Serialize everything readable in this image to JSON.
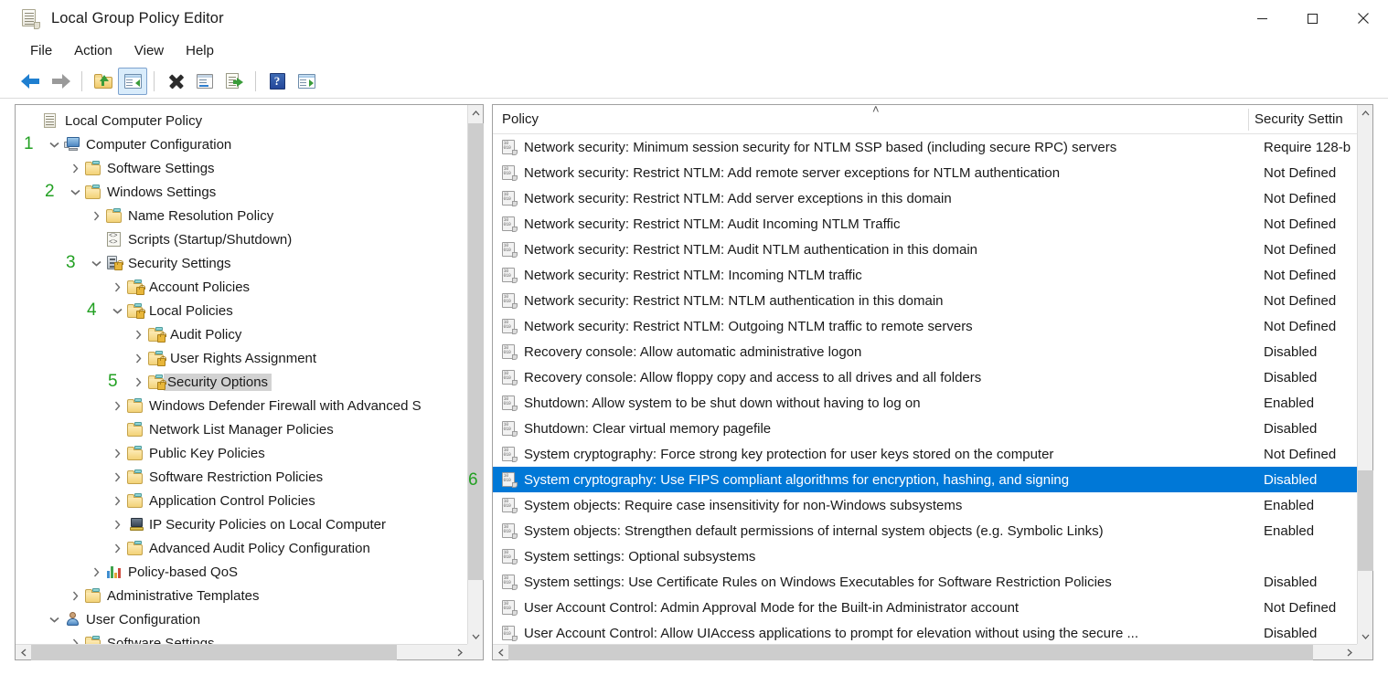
{
  "window": {
    "title": "Local Group Policy Editor",
    "icon": "policy-scroll-icon",
    "controls": {
      "minimize": "—",
      "maximize": "□",
      "close": "✕"
    }
  },
  "menu": {
    "items": [
      "File",
      "Action",
      "View",
      "Help"
    ]
  },
  "toolbar": {
    "items": [
      {
        "name": "back-button",
        "icon": "back-arrow-icon",
        "active": false
      },
      {
        "name": "forward-button",
        "icon": "forward-arrow-icon",
        "active": false
      },
      {
        "name": "up-one-level-button",
        "icon": "folder-up-icon",
        "active": false
      },
      {
        "name": "show-hide-tree-button",
        "icon": "show-tree-icon",
        "active": true
      },
      {
        "name": "delete-button",
        "icon": "delete-x-icon",
        "active": false
      },
      {
        "name": "properties-button",
        "icon": "properties-icon",
        "active": false
      },
      {
        "name": "export-list-button",
        "icon": "export-list-icon",
        "active": false
      },
      {
        "name": "help-button",
        "icon": "help-question-icon",
        "active": false
      },
      {
        "name": "show-action-pane-button",
        "icon": "action-pane-icon",
        "active": false
      }
    ]
  },
  "tree": {
    "items": [
      {
        "label": "Local Computer Policy",
        "indent": 0,
        "chevron": "none",
        "icon": "policy-scroll-icon",
        "selected": false,
        "annotation": ""
      },
      {
        "label": "Computer Configuration",
        "indent": 1,
        "chevron": "down",
        "icon": "computer-icon",
        "selected": false,
        "annotation": "1"
      },
      {
        "label": "Software Settings",
        "indent": 2,
        "chevron": "right",
        "icon": "folder-icon",
        "selected": false,
        "annotation": ""
      },
      {
        "label": "Windows Settings",
        "indent": 2,
        "chevron": "down",
        "icon": "folder-icon",
        "selected": false,
        "annotation": "2"
      },
      {
        "label": "Name Resolution Policy",
        "indent": 3,
        "chevron": "right",
        "icon": "folder-icon",
        "selected": false,
        "annotation": ""
      },
      {
        "label": "Scripts (Startup/Shutdown)",
        "indent": 3,
        "chevron": "none",
        "icon": "script-icon",
        "selected": false,
        "annotation": ""
      },
      {
        "label": "Security Settings",
        "indent": 3,
        "chevron": "down",
        "icon": "security-settings-icon",
        "selected": false,
        "annotation": "3"
      },
      {
        "label": "Account Policies",
        "indent": 4,
        "chevron": "right",
        "icon": "folder-lock-icon",
        "selected": false,
        "annotation": ""
      },
      {
        "label": "Local Policies",
        "indent": 4,
        "chevron": "down",
        "icon": "folder-lock-icon",
        "selected": false,
        "annotation": "4"
      },
      {
        "label": "Audit Policy",
        "indent": 5,
        "chevron": "right",
        "icon": "folder-lock-icon",
        "selected": false,
        "annotation": ""
      },
      {
        "label": "User Rights Assignment",
        "indent": 5,
        "chevron": "right",
        "icon": "folder-lock-icon",
        "selected": false,
        "annotation": ""
      },
      {
        "label": "Security Options",
        "indent": 5,
        "chevron": "right",
        "icon": "folder-lock-icon",
        "selected": true,
        "annotation": "5"
      },
      {
        "label": "Windows Defender Firewall with Advanced S",
        "indent": 4,
        "chevron": "right",
        "icon": "folder-icon",
        "selected": false,
        "annotation": ""
      },
      {
        "label": "Network List Manager Policies",
        "indent": 4,
        "chevron": "none",
        "icon": "folder-icon",
        "selected": false,
        "annotation": ""
      },
      {
        "label": "Public Key Policies",
        "indent": 4,
        "chevron": "right",
        "icon": "folder-icon",
        "selected": false,
        "annotation": ""
      },
      {
        "label": "Software Restriction Policies",
        "indent": 4,
        "chevron": "right",
        "icon": "folder-icon",
        "selected": false,
        "annotation": ""
      },
      {
        "label": "Application Control Policies",
        "indent": 4,
        "chevron": "right",
        "icon": "folder-icon",
        "selected": false,
        "annotation": ""
      },
      {
        "label": "IP Security Policies on Local Computer",
        "indent": 4,
        "chevron": "right",
        "icon": "ip-security-icon",
        "selected": false,
        "annotation": ""
      },
      {
        "label": "Advanced Audit Policy Configuration",
        "indent": 4,
        "chevron": "right",
        "icon": "folder-icon",
        "selected": false,
        "annotation": ""
      },
      {
        "label": "Policy-based QoS",
        "indent": 3,
        "chevron": "right",
        "icon": "qos-chart-icon",
        "selected": false,
        "annotation": ""
      },
      {
        "label": "Administrative Templates",
        "indent": 2,
        "chevron": "right",
        "icon": "folder-icon",
        "selected": false,
        "annotation": ""
      },
      {
        "label": "User Configuration",
        "indent": 1,
        "chevron": "down",
        "icon": "user-icon",
        "selected": false,
        "annotation": ""
      },
      {
        "label": "Software Settings",
        "indent": 2,
        "chevron": "right",
        "icon": "folder-icon",
        "selected": false,
        "annotation": ""
      }
    ]
  },
  "list": {
    "columns": [
      "Policy",
      "Security Settin"
    ],
    "sort_indicator": "˄",
    "rows": [
      {
        "policy": "Network security: Minimum session security for NTLM SSP based (including secure RPC) servers",
        "setting": "Require 128-b",
        "selected": false
      },
      {
        "policy": "Network security: Restrict NTLM: Add remote server exceptions for NTLM authentication",
        "setting": "Not Defined",
        "selected": false
      },
      {
        "policy": "Network security: Restrict NTLM: Add server exceptions in this domain",
        "setting": "Not Defined",
        "selected": false
      },
      {
        "policy": "Network security: Restrict NTLM: Audit Incoming NTLM Traffic",
        "setting": "Not Defined",
        "selected": false
      },
      {
        "policy": "Network security: Restrict NTLM: Audit NTLM authentication in this domain",
        "setting": "Not Defined",
        "selected": false
      },
      {
        "policy": "Network security: Restrict NTLM: Incoming NTLM traffic",
        "setting": "Not Defined",
        "selected": false
      },
      {
        "policy": "Network security: Restrict NTLM: NTLM authentication in this domain",
        "setting": "Not Defined",
        "selected": false
      },
      {
        "policy": "Network security: Restrict NTLM: Outgoing NTLM traffic to remote servers",
        "setting": "Not Defined",
        "selected": false
      },
      {
        "policy": "Recovery console: Allow automatic administrative logon",
        "setting": "Disabled",
        "selected": false
      },
      {
        "policy": "Recovery console: Allow floppy copy and access to all drives and all folders",
        "setting": "Disabled",
        "selected": false
      },
      {
        "policy": "Shutdown: Allow system to be shut down without having to log on",
        "setting": "Enabled",
        "selected": false
      },
      {
        "policy": "Shutdown: Clear virtual memory pagefile",
        "setting": "Disabled",
        "selected": false
      },
      {
        "policy": "System cryptography: Force strong key protection for user keys stored on the computer",
        "setting": "Not Defined",
        "selected": false
      },
      {
        "policy": "System cryptography: Use FIPS compliant algorithms for encryption, hashing, and signing",
        "setting": "Disabled",
        "selected": true
      },
      {
        "policy": "System objects: Require case insensitivity for non-Windows subsystems",
        "setting": "Enabled",
        "selected": false
      },
      {
        "policy": "System objects: Strengthen default permissions of internal system objects (e.g. Symbolic Links)",
        "setting": "Enabled",
        "selected": false
      },
      {
        "policy": "System settings: Optional subsystems",
        "setting": "",
        "selected": false
      },
      {
        "policy": "System settings: Use Certificate Rules on Windows Executables for Software Restriction Policies",
        "setting": "Disabled",
        "selected": false
      },
      {
        "policy": "User Account Control: Admin Approval Mode for the Built-in Administrator account",
        "setting": "Not Defined",
        "selected": false
      },
      {
        "policy": "User Account Control: Allow UIAccess applications to prompt for elevation without using the secure ...",
        "setting": "Disabled",
        "selected": false
      }
    ]
  },
  "annotations": {
    "color": "#22a022",
    "numbers": [
      "1",
      "2",
      "3",
      "4",
      "5",
      "6"
    ],
    "six_label": "6"
  },
  "colors": {
    "selection_blue": "#0078d7",
    "tree_selection_gray": "#d2d2d2",
    "annotation_green": "#22a022",
    "scrollbar_track": "#f0f0f0",
    "scrollbar_thumb": "#cdcdcd"
  }
}
